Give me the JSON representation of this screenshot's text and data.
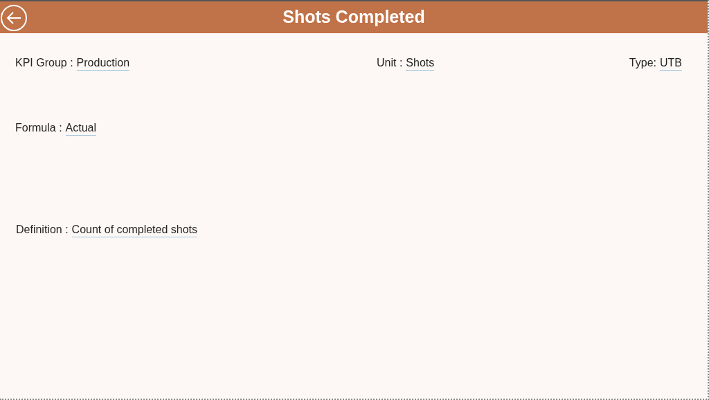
{
  "header": {
    "title": "Shots Completed"
  },
  "rows": [
    [
      {
        "label": "KPI Group :",
        "value": "Production"
      },
      {
        "label": "Unit :",
        "value": "Shots"
      },
      {
        "label": "Type:",
        "value": "UTB"
      }
    ],
    [
      {
        "label": "Formula :",
        "value": "Actual"
      }
    ],
    [
      {
        "label": "Definition :",
        "value": "Count of completed shots"
      }
    ]
  ]
}
